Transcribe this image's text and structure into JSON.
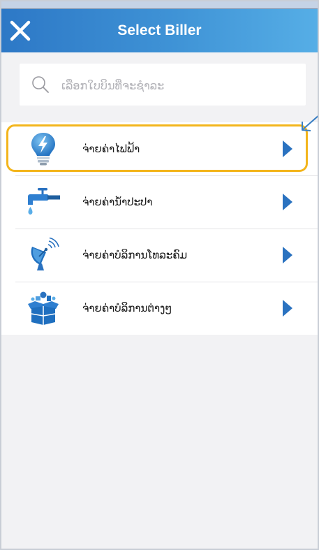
{
  "header": {
    "title": "Select Biller",
    "close_icon": "close-icon"
  },
  "search": {
    "placeholder": "ເລືອກໃບບິນທີ່ຈະຊຳລະ",
    "value": "",
    "icon": "search-icon"
  },
  "billers": [
    {
      "label": "ຈ່າຍຄ່າໄຟຟ້າ",
      "icon": "lightbulb-icon",
      "highlighted": true
    },
    {
      "label": "ຈ່າຍຄ່ານ້ຳປະປາ",
      "icon": "water-tap-icon",
      "highlighted": false
    },
    {
      "label": "ຈ່າຍຄ່າບໍລິການໂທລະຄົມ",
      "icon": "satellite-dish-icon",
      "highlighted": false
    },
    {
      "label": "ຈ່າຍຄ່າບໍລິການຕ່າງໆ",
      "icon": "open-box-icon",
      "highlighted": false
    }
  ],
  "colors": {
    "header_start": "#2d78c6",
    "header_end": "#56aee6",
    "accent_blue": "#2a72c0",
    "highlight": "#f3b51c",
    "background": "#f2f2f4"
  }
}
